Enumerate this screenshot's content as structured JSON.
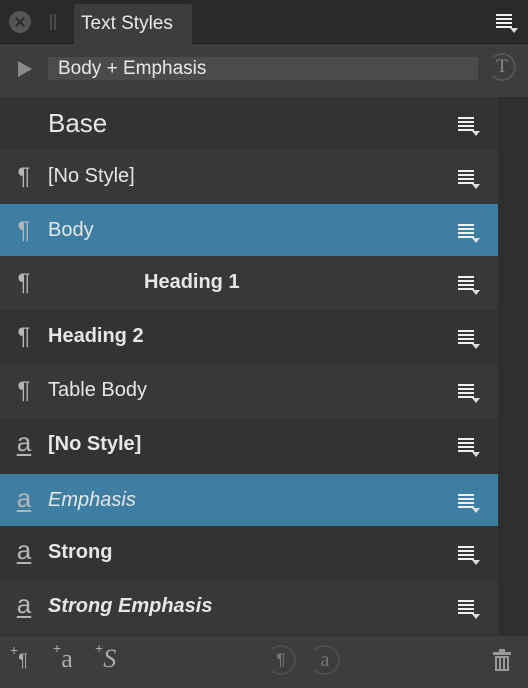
{
  "panel": {
    "tab_title": "Text Styles",
    "close_icon": "close-icon",
    "grip_icon": "drag-grip-icon",
    "panel_menu_icon": "panel-menu-icon"
  },
  "header": {
    "expand_icon": "play-triangle-icon",
    "current_style": "Body + Emphasis",
    "style_button_glyph": "T"
  },
  "styles": {
    "group_base": "Base",
    "items": [
      {
        "type": "paragraph",
        "icon": "¶",
        "label": "[No Style]",
        "weight": "normal",
        "style": "normal",
        "selected": false
      },
      {
        "type": "paragraph",
        "icon": "¶",
        "label": "Body",
        "weight": "normal",
        "style": "normal",
        "selected": true
      },
      {
        "type": "paragraph",
        "icon": "¶",
        "label": "Heading 1",
        "weight": "bold",
        "style": "normal",
        "selected": false,
        "align": "center"
      },
      {
        "type": "paragraph",
        "icon": "¶",
        "label": "Heading 2",
        "weight": "bold",
        "style": "normal",
        "selected": false
      },
      {
        "type": "paragraph",
        "icon": "¶",
        "label": "Table Body",
        "weight": "normal",
        "style": "normal",
        "selected": false
      },
      {
        "type": "character",
        "icon": "a",
        "label": "[No Style]",
        "weight": "semibold",
        "style": "normal",
        "selected": false
      },
      {
        "type": "character",
        "icon": "a",
        "label": "Emphasis",
        "weight": "normal",
        "style": "italic",
        "selected": true
      },
      {
        "type": "character",
        "icon": "a",
        "label": "Strong",
        "weight": "bold",
        "style": "normal",
        "selected": false
      },
      {
        "type": "character",
        "icon": "a",
        "label": "Strong Emphasis",
        "weight": "bold",
        "style": "italic",
        "selected": false
      }
    ]
  },
  "footer": {
    "add_paragraph": {
      "plus": "+",
      "glyph": "¶"
    },
    "add_character": {
      "plus": "+",
      "glyph": "a"
    },
    "add_group": {
      "plus": "+",
      "glyph": "S"
    },
    "paragraph_circle_glyph": "¶",
    "character_circle_glyph": "a",
    "delete_icon": "trash-icon"
  },
  "colors": {
    "selection": "#3e7ea2",
    "panel_bg": "#333333",
    "header_bg": "#3d3d3d"
  }
}
